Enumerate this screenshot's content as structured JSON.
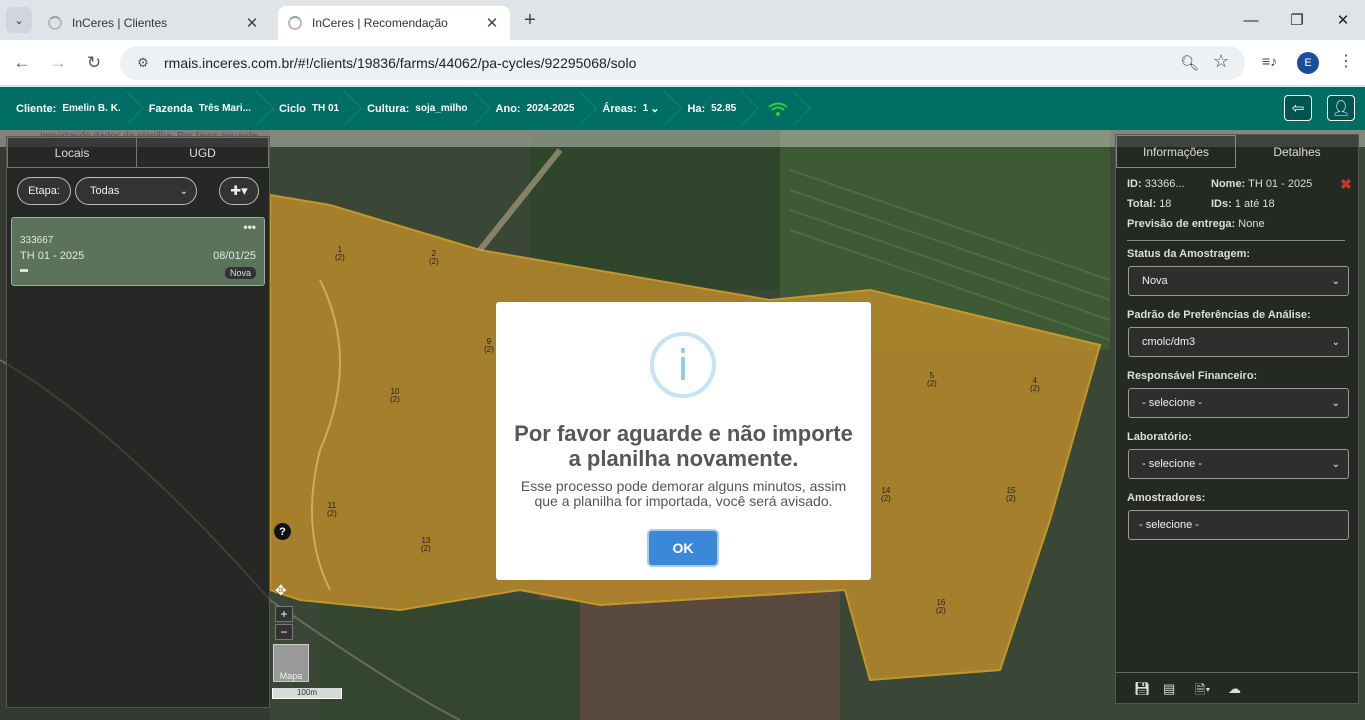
{
  "browser": {
    "tabs": [
      {
        "title": "InCeres | Clientes",
        "active": false
      },
      {
        "title": "InCeres | Recomendação",
        "active": true
      }
    ],
    "url": "rmais.inceres.com.br/#!/clients/19836/farms/44062/pa-cycles/92295068/solo",
    "profile_initial": "E"
  },
  "header": {
    "crumbs": [
      {
        "label": "Cliente:",
        "value": "Emelin B. K."
      },
      {
        "label": "Fazenda",
        "value": "Três Mari..."
      },
      {
        "label": "Ciclo",
        "value": "TH 01"
      },
      {
        "label": "Cultura:",
        "value": "soja_milho"
      },
      {
        "label": "Ano:",
        "value": "2024-2025"
      },
      {
        "label": "Áreas:",
        "value": "1"
      },
      {
        "label": "Ha:",
        "value": "52.85"
      }
    ]
  },
  "loading_text": "Importando dados da planilha. Por favor aguarde...",
  "left_panel": {
    "tabs": [
      "Locais",
      "UGD"
    ],
    "etapa_label": "Etapa:",
    "etapa_value": "Todas",
    "card": {
      "id": "333667",
      "name": "TH 01 - 2025",
      "date": "08/01/25",
      "badge": "Nova",
      "menu": "•••"
    }
  },
  "right_panel": {
    "tabs": [
      "Informações",
      "Detalhes"
    ],
    "id_label": "ID:",
    "id_value": "33366...",
    "nome_label": "Nome:",
    "nome_value": "TH 01 - 2025",
    "total_label": "Total:",
    "total_value": "18",
    "ids_label": "IDs:",
    "ids_value": "1 até 18",
    "previsao_label": "Previsão de entrega:",
    "previsao_value": "None",
    "fields": [
      {
        "label": "Status da Amostragem:",
        "value": "Nova"
      },
      {
        "label": "Padrão de Preferências de Análise:",
        "value": "cmolc/dm3"
      },
      {
        "label": "Responsável Financeiro:",
        "value": "- selecione -"
      },
      {
        "label": "Laboratório:",
        "value": "- selecione -"
      },
      {
        "label": "Amostradores:",
        "value": "- selecione -"
      }
    ]
  },
  "map": {
    "points": [
      {
        "n": "1",
        "sub": "(2)"
      },
      {
        "n": "2",
        "sub": "(2)"
      },
      {
        "n": "9",
        "sub": "(2)"
      },
      {
        "n": "10",
        "sub": "(2)"
      },
      {
        "n": "11",
        "sub": "(2)"
      },
      {
        "n": "13",
        "sub": "(2)"
      },
      {
        "n": "5",
        "sub": "(2)"
      },
      {
        "n": "4",
        "sub": "(2)"
      },
      {
        "n": "14",
        "sub": "(2)"
      },
      {
        "n": "15",
        "sub": "(2)"
      },
      {
        "n": "16",
        "sub": "(2)"
      }
    ],
    "scale": "100m",
    "basemap_label": "Mapa",
    "zoom_in": "+",
    "zoom_out": "−",
    "help": "?"
  },
  "modal": {
    "icon": "i",
    "title": "Por favor aguarde e não importe a planilha novamente.",
    "text": "Esse processo pode demorar alguns minutos, assim que a planilha for importada, você será avisado.",
    "ok_label": "OK"
  },
  "colors": {
    "header": "#006e64",
    "field": "#c8961e",
    "ok_button": "#3a88d8",
    "info_icon": "#87cdeb"
  }
}
